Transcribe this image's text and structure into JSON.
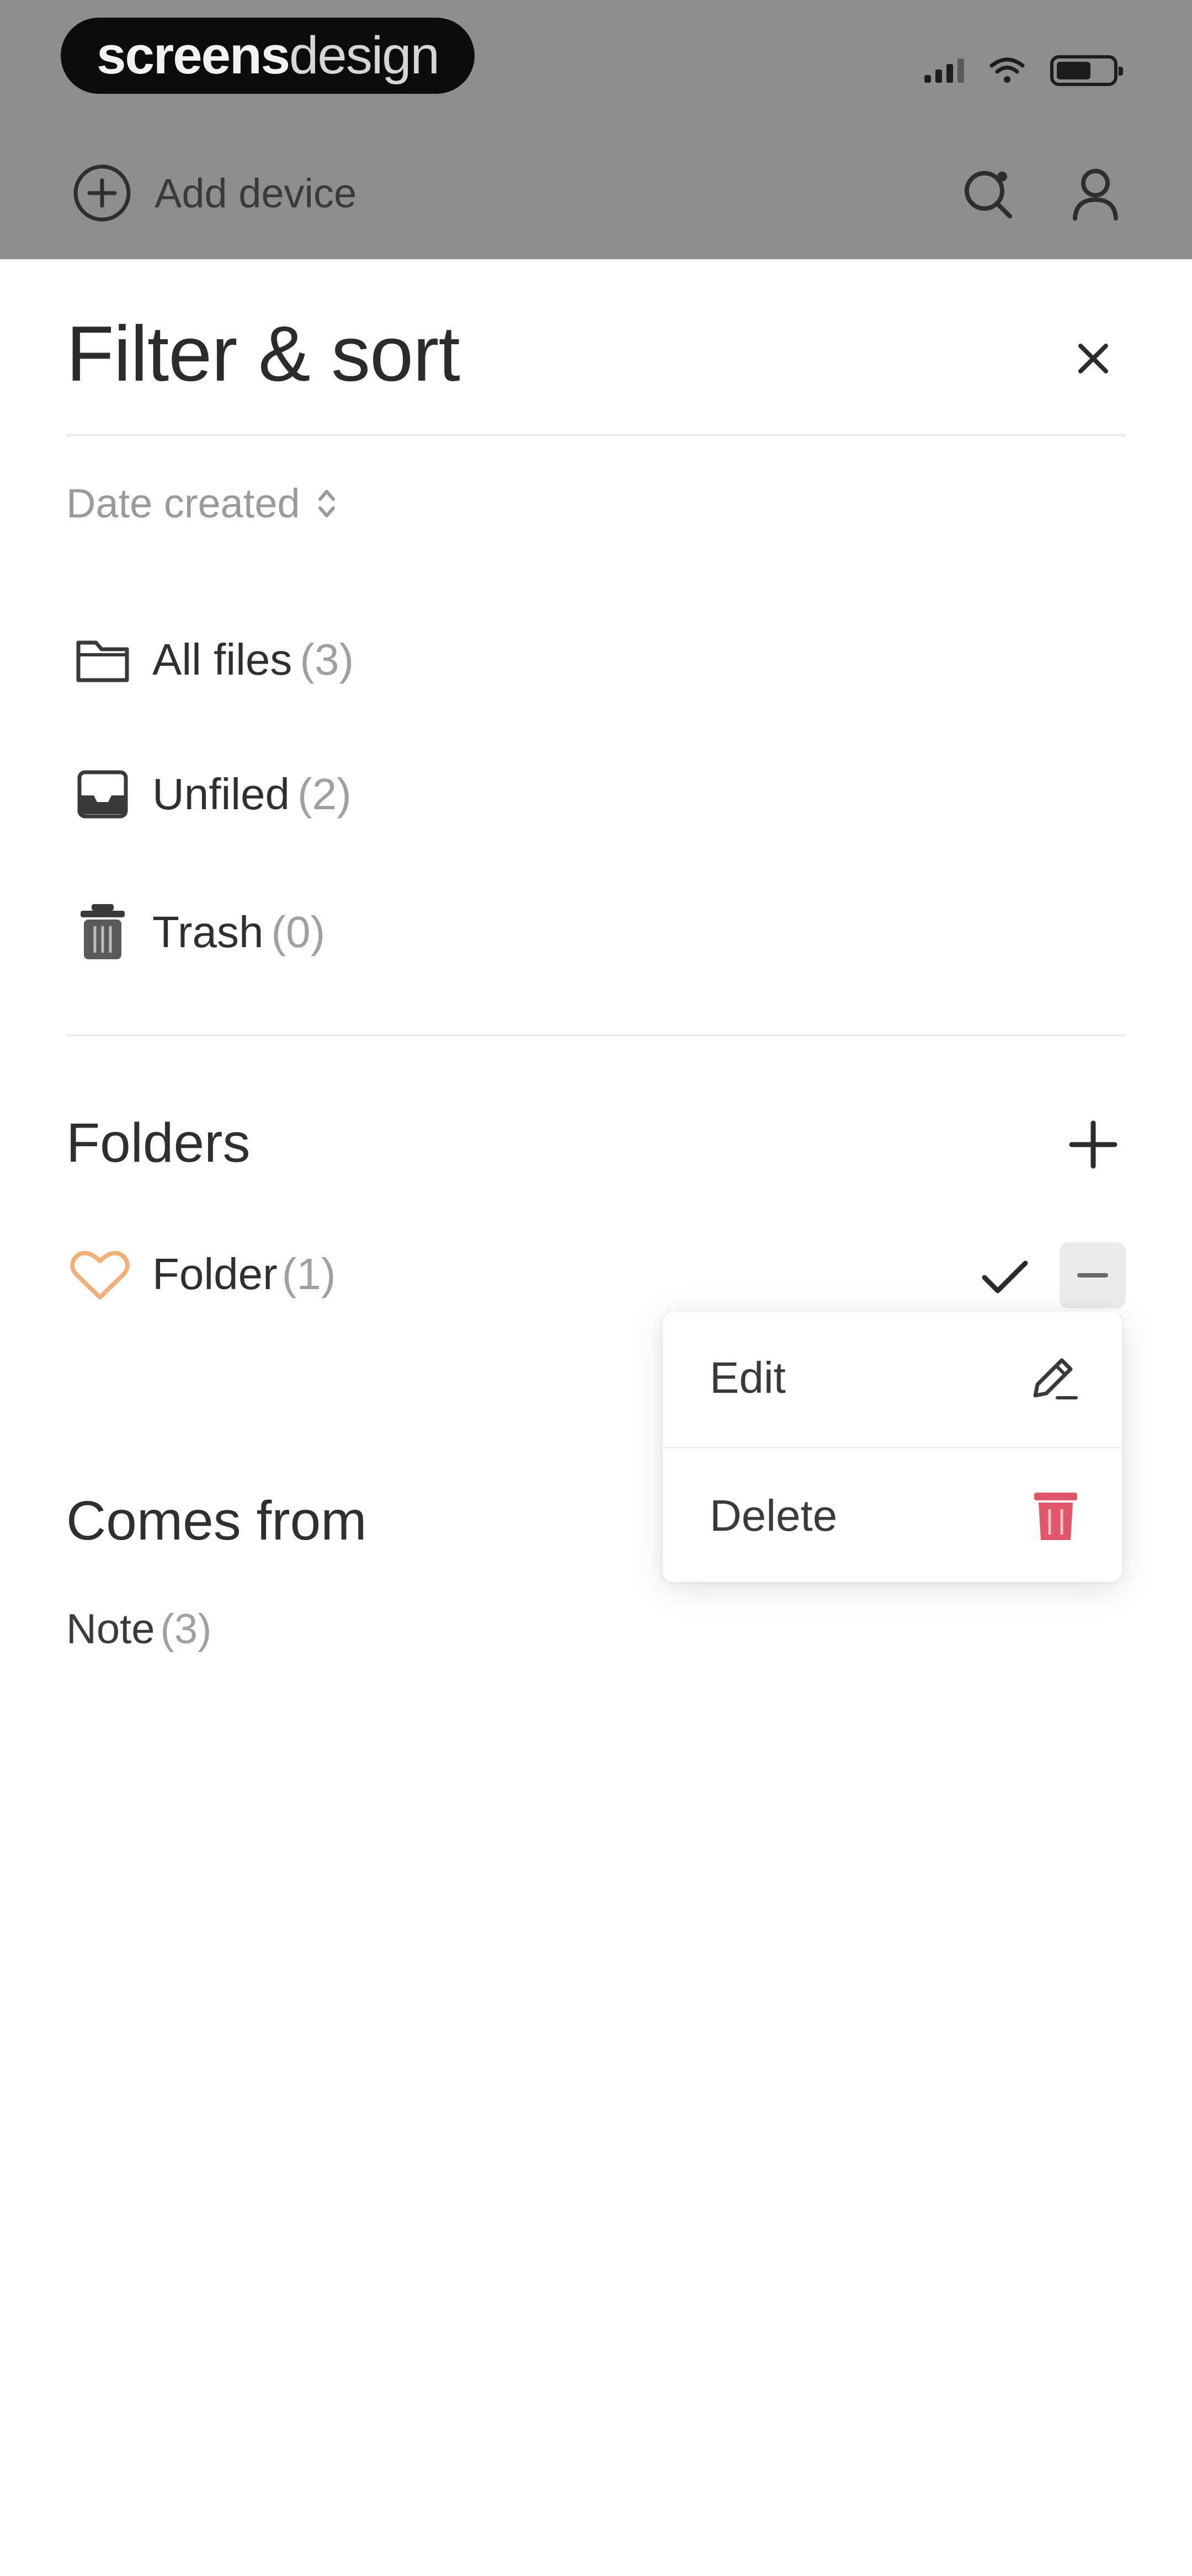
{
  "status_bar": {
    "logo_bold": "screens",
    "logo_light": "design"
  },
  "app_header": {
    "add_device_label": "Add device"
  },
  "sheet": {
    "title": "Filter & sort",
    "sort_label": "Date created",
    "nav_items": [
      {
        "label": "All files",
        "count": "(3)",
        "icon": "folder-icon"
      },
      {
        "label": "Unfiled",
        "count": "(2)",
        "icon": "inbox-icon"
      },
      {
        "label": "Trash",
        "count": "(0)",
        "icon": "trash-icon"
      }
    ],
    "folders_heading": "Folders",
    "folders": [
      {
        "label": "Folder",
        "count": "(1)",
        "icon": "heart-icon"
      }
    ],
    "folder_menu": {
      "edit_label": "Edit",
      "delete_label": "Delete"
    },
    "comes_from_heading": "Comes from",
    "sources": [
      {
        "label": "Note",
        "count": "(3)"
      }
    ]
  },
  "colors": {
    "backdrop": "#8e8e8e",
    "heart_accent": "#f0b07a",
    "delete_accent": "#e0566b",
    "text_primary": "#2b2b2b",
    "text_muted": "#a0a0a0"
  }
}
